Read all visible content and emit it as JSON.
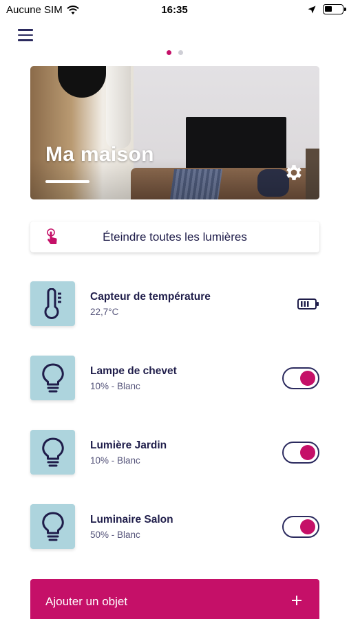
{
  "status_bar": {
    "carrier": "Aucune SIM",
    "time": "16:35",
    "icons": [
      "wifi-icon",
      "location-arrow-icon",
      "battery-icon"
    ]
  },
  "navigation": {
    "menu_icon": "hamburger-icon",
    "page_count": 2,
    "active_page": 1
  },
  "home_card": {
    "title": "Ma maison",
    "settings_icon": "gear-icon"
  },
  "lights_off": {
    "label": "Éteindre toutes les lumières",
    "icon": "touch-icon"
  },
  "devices": [
    {
      "name": "Capteur de température",
      "status": "22,7°C",
      "icon": "thermometer-icon",
      "trailing": "battery-icon"
    },
    {
      "name": "Lampe de chevet",
      "status": "10% -  Blanc",
      "icon": "lightbulb-icon",
      "trailing": "toggle",
      "on": true
    },
    {
      "name": "Lumière Jardin",
      "status": "10% -  Blanc",
      "icon": "lightbulb-icon",
      "trailing": "toggle",
      "on": true
    },
    {
      "name": "Luminaire Salon",
      "status": "50% -  Blanc",
      "icon": "lightbulb-icon",
      "trailing": "toggle",
      "on": true
    }
  ],
  "add_object": {
    "label": "Ajouter un objet",
    "icon": "plus-icon"
  },
  "colors": {
    "accent": "#c51068",
    "navy": "#1f1d4a",
    "icon_tile": "#add4dd"
  }
}
